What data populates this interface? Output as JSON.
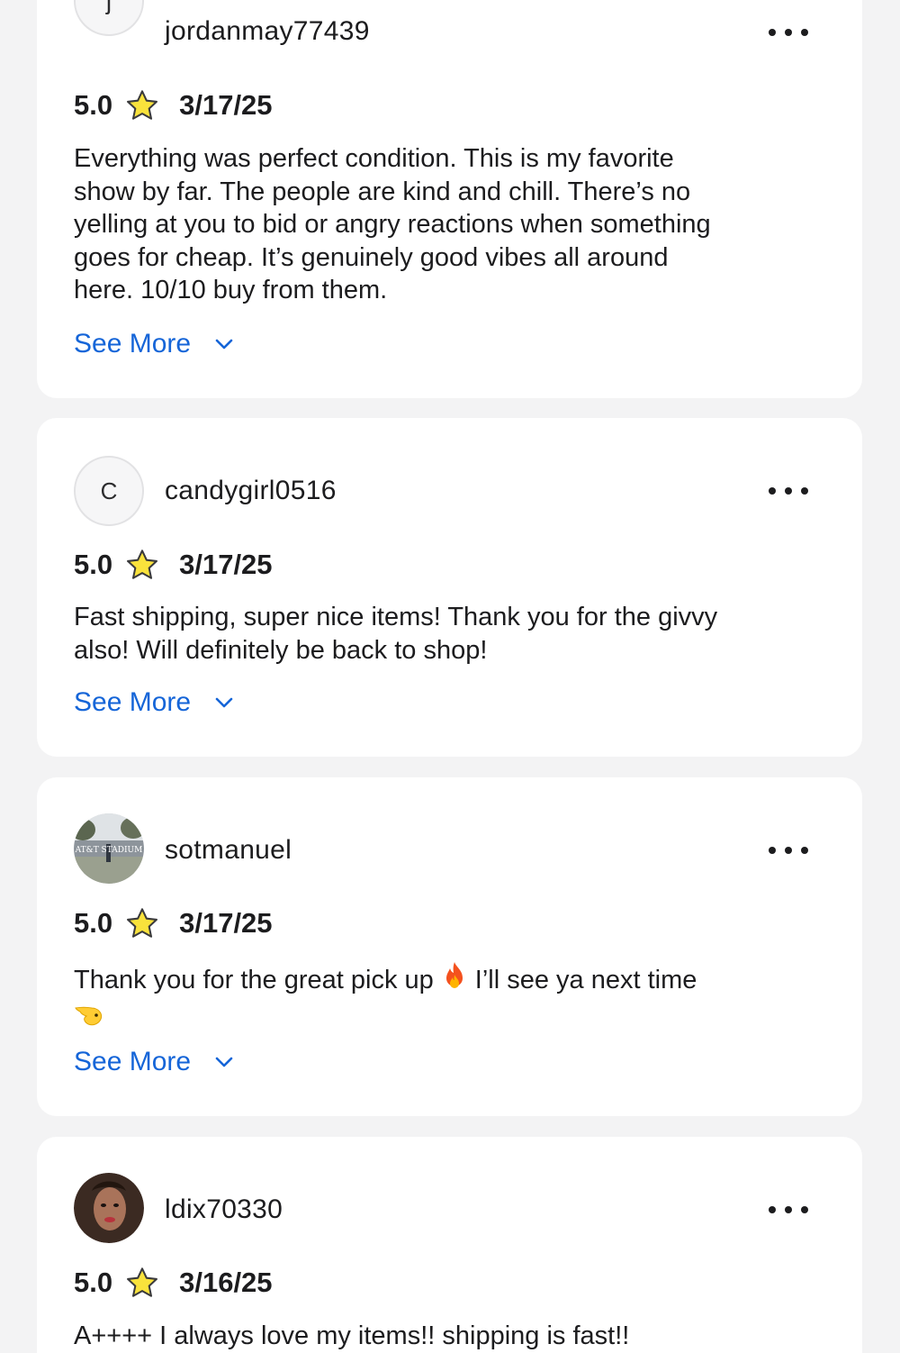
{
  "reviews": [
    {
      "avatar_initial": "j",
      "username": "jordanmay77439",
      "rating": "5.0",
      "date": "3/17/25",
      "text": "Everything was perfect condition. This is my favorite\nshow by far. The people are kind and chill. There’s no\nyelling at you to bid or angry reactions when something\ngoes for cheap. It’s genuinely good vibes all around\nhere. 10/10 buy from them.",
      "see_more": "See More"
    },
    {
      "avatar_initial": "C",
      "username": "candygirl0516",
      "rating": "5.0",
      "date": "3/17/25",
      "text": "Fast shipping, super nice items! Thank you for the givvy\nalso! Will definitely be back to shop!",
      "see_more": "See More"
    },
    {
      "avatar_photo": "stadium-photo",
      "avatar_photo_text": "AT&T STADIUM",
      "username": "sotmanuel",
      "rating": "5.0",
      "date": "3/17/25",
      "text_part1": "Thank you for the great pick up",
      "text_part2": "I’ll see ya next time",
      "see_more": "See More"
    },
    {
      "avatar_photo": "portrait-photo",
      "username": "ldix70330",
      "rating": "5.0",
      "date": "3/16/25",
      "text": "A++++ I always love my items!! shipping is fast!!"
    }
  ],
  "icons": {
    "star": "star-icon",
    "more": "more-options-icon",
    "chevron": "chevron-down-icon",
    "fire": "fire-emoji",
    "hand": "pointing-hand-emoji"
  },
  "colors": {
    "link": "#1565d8",
    "star_fill": "#f9e23c",
    "star_stroke": "#3a3a3c",
    "card": "#ffffff",
    "background": "#f3f3f4"
  }
}
